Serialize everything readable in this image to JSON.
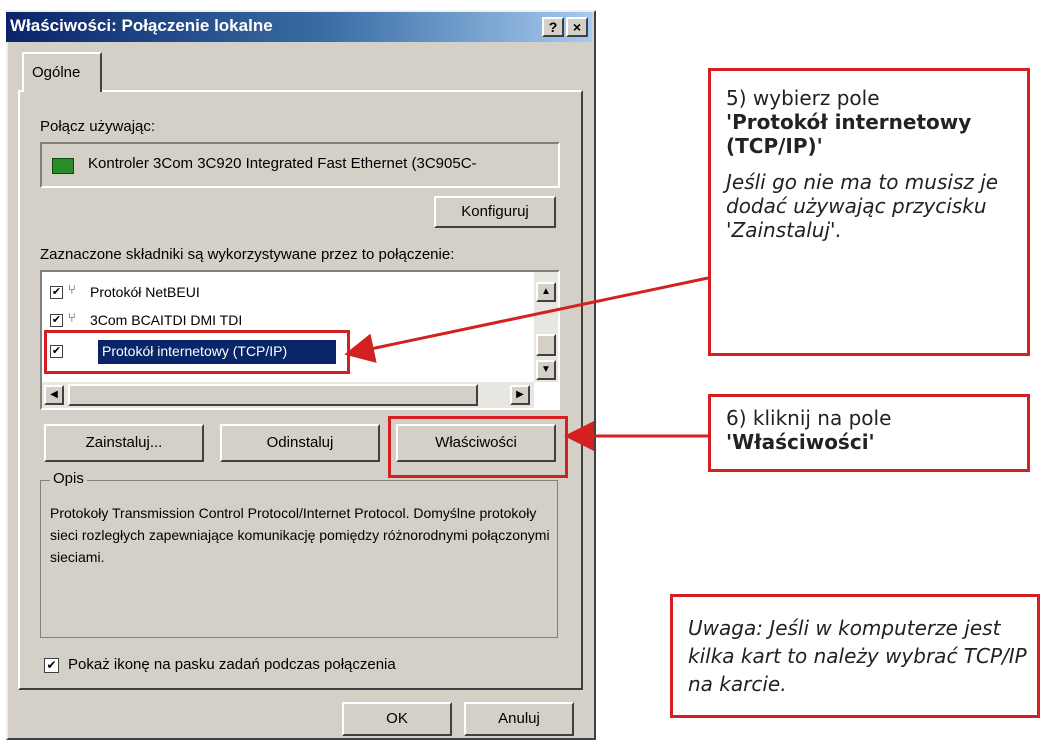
{
  "dialog": {
    "title": "Właściwości: Połączenie lokalne",
    "help_btn": "?",
    "close_btn": "×",
    "tab_general": "Ogólne",
    "connect_using_label": "Połącz używając:",
    "adapter_name": "Kontroler 3Com 3C920 Integrated Fast Ethernet (3C905C-",
    "configure_btn": "Konfiguruj",
    "components_label": "Zaznaczone składniki są wykorzystywane przez to połączenie:",
    "components": [
      {
        "label": "Protokół NetBEUI",
        "checked": true
      },
      {
        "label": "3Com BCAITDI DMI TDI",
        "checked": true
      },
      {
        "label": "Protokół internetowy (TCP/IP)",
        "checked": true
      }
    ],
    "install_btn": "Zainstaluj...",
    "uninstall_btn": "Odinstaluj",
    "properties_btn": "Właściwości",
    "description_group": "Opis",
    "description_text": "Protokoły Transmission Control Protocol/Internet Protocol. Domyślne protokoły sieci rozległych zapewniające komunikację pomiędzy różnorodnymi połączonymi sieciami.",
    "show_icon_label": "Pokaż ikonę na pasku zadań podczas połączenia",
    "show_icon_checked": true,
    "ok_btn": "OK",
    "cancel_btn": "Anuluj"
  },
  "callouts": {
    "step5_prefix": "5) wybierz pole",
    "step5_bold": "'Protokół internetowy (TCP/IP)'",
    "step5_note": "Jeśli go nie ma to musisz je dodać używając przycisku 'Zainstaluj'.",
    "step6_prefix": "6) kliknij na pole",
    "step6_bold": "'Właściwości'",
    "warning": "Uwaga: Jeśli w komputerze jest kilka kart to należy wybrać TCP/IP na karcie."
  },
  "colors": {
    "highlight_red": "#d42020",
    "titlebar_blue": "#0a246a",
    "dialog_face": "#d4d0c8"
  }
}
